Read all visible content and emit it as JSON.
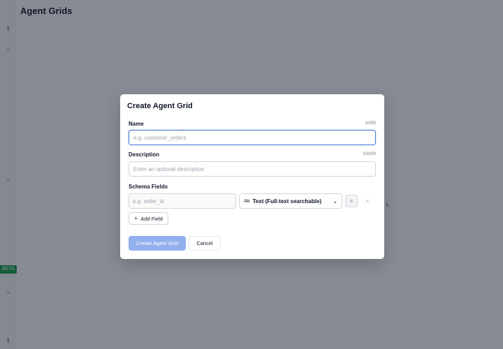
{
  "page": {
    "title": "Agent Grids",
    "sidebar_badge": "BETA",
    "background_fragment": "s."
  },
  "modal": {
    "title": "Create Agent Grid",
    "name": {
      "label": "Name",
      "counter": "0/255",
      "placeholder": "e.g. customer_orders",
      "value": ""
    },
    "description": {
      "label": "Description",
      "counter": "0/1000",
      "placeholder": "Enter an optional description",
      "value": ""
    },
    "schema": {
      "label": "Schema Fields",
      "fields": [
        {
          "name_placeholder": "e.g. order_id",
          "type_label": "Text (Full-text searchable)",
          "type_icon": "text-type-icon"
        }
      ],
      "add_field_label": "Add Field"
    },
    "buttons": {
      "create_label": "Create Agent Grid",
      "cancel_label": "Cancel"
    }
  },
  "colors": {
    "overlay": "#111827",
    "primary_button": "#93b0ee",
    "focus_border": "#4a7bd0",
    "badge": "#16a34a"
  }
}
